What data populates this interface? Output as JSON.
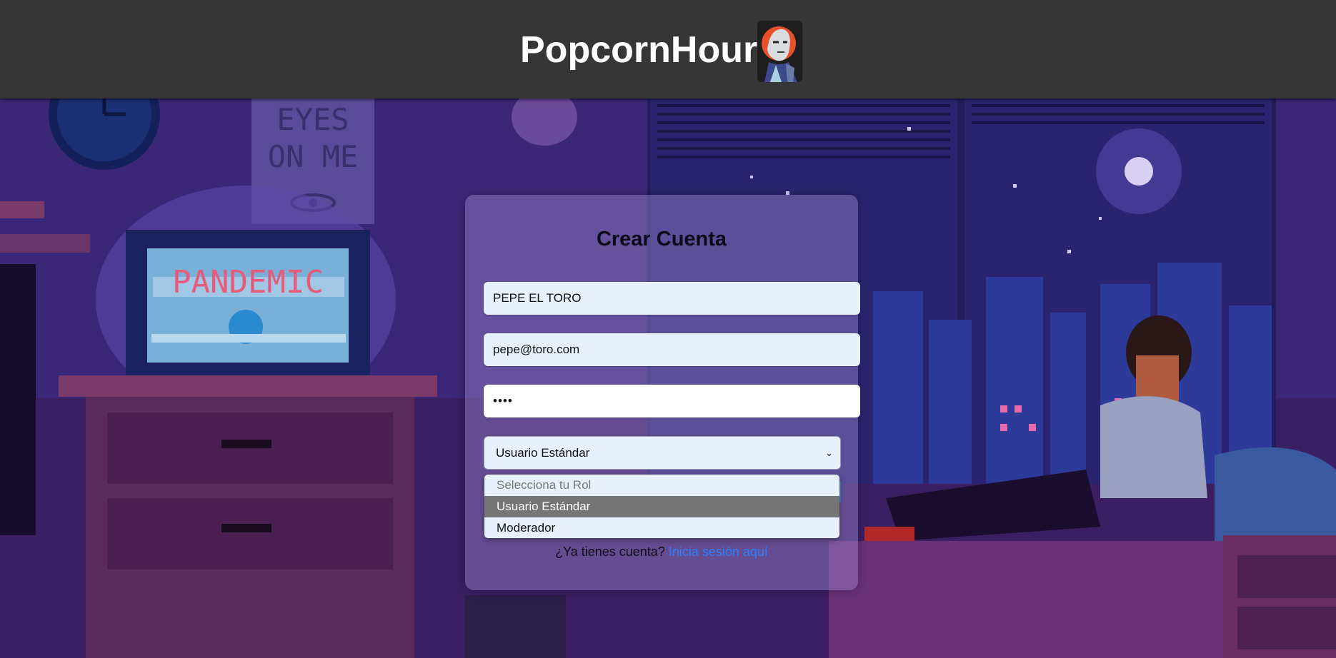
{
  "header": {
    "brand": "PopcornHour",
    "logo_icon": "masked-figure-logo"
  },
  "background": {
    "scene": "pixel-art-bedroom-night",
    "poster_text": "ALL EYES ON ME",
    "tv_text": "PANDEMIC"
  },
  "form": {
    "title": "Crear Cuenta",
    "name_value": "PEPE EL TORO",
    "email_value": "pepe@toro.com",
    "password_value": "••••",
    "role_value": "Usuario Estándar",
    "role_options": [
      "Selecciona tu Rol",
      "Usuario Estándar",
      "Moderador"
    ],
    "login_prompt": "¿Ya tienes cuenta?",
    "login_link": "Inicia sesión aquí"
  },
  "colors": {
    "header_bg": "#363636",
    "link": "#2a7fff",
    "selected_option": "#757575"
  }
}
